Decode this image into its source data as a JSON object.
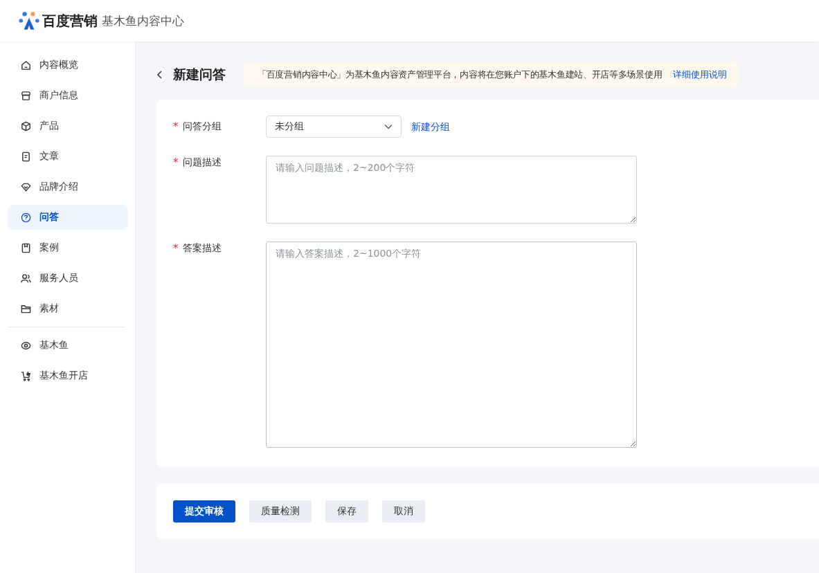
{
  "header": {
    "brand": "百度营销",
    "product": "基木鱼内容中心"
  },
  "sidebar": {
    "sections": [
      {
        "items": [
          {
            "label": "内容概览",
            "selected": false
          },
          {
            "label": "商户信息",
            "selected": false
          },
          {
            "label": "产品",
            "selected": false
          },
          {
            "label": "文章",
            "selected": false
          },
          {
            "label": "品牌介绍",
            "selected": false
          },
          {
            "label": "问答",
            "selected": true
          },
          {
            "label": "案例",
            "selected": false
          },
          {
            "label": "服务人员",
            "selected": false
          },
          {
            "label": "素材",
            "selected": false
          }
        ]
      },
      {
        "items": [
          {
            "label": "基木鱼",
            "selected": false
          },
          {
            "label": "基木鱼开店",
            "selected": false
          }
        ]
      }
    ]
  },
  "page": {
    "title": "新建问答",
    "notice": "「百度营销内容中心」为基木鱼内容资产管理平台，内容将在您账户下的基木鱼建站、开店等多场景使用",
    "notice_link": "详细使用说明"
  },
  "form": {
    "fields": [
      {
        "kind": "select",
        "label": "问答分组",
        "required_mark": "*",
        "value": "未分组",
        "action": "新建分组"
      },
      {
        "kind": "textarea",
        "label": "问题描述",
        "required_mark": "*",
        "placeholder": "请输入问题描述，2~200个字符"
      },
      {
        "kind": "textarea",
        "label": "答案描述",
        "required_mark": "*",
        "placeholder": "请输入答案描述，2~1000个字符"
      }
    ]
  },
  "buttons": [
    {
      "label": "提交审核",
      "kind": "primary"
    },
    {
      "label": "质量检测",
      "kind": "default"
    },
    {
      "label": "保存",
      "kind": "default"
    },
    {
      "label": "取消",
      "kind": "default"
    }
  ]
}
